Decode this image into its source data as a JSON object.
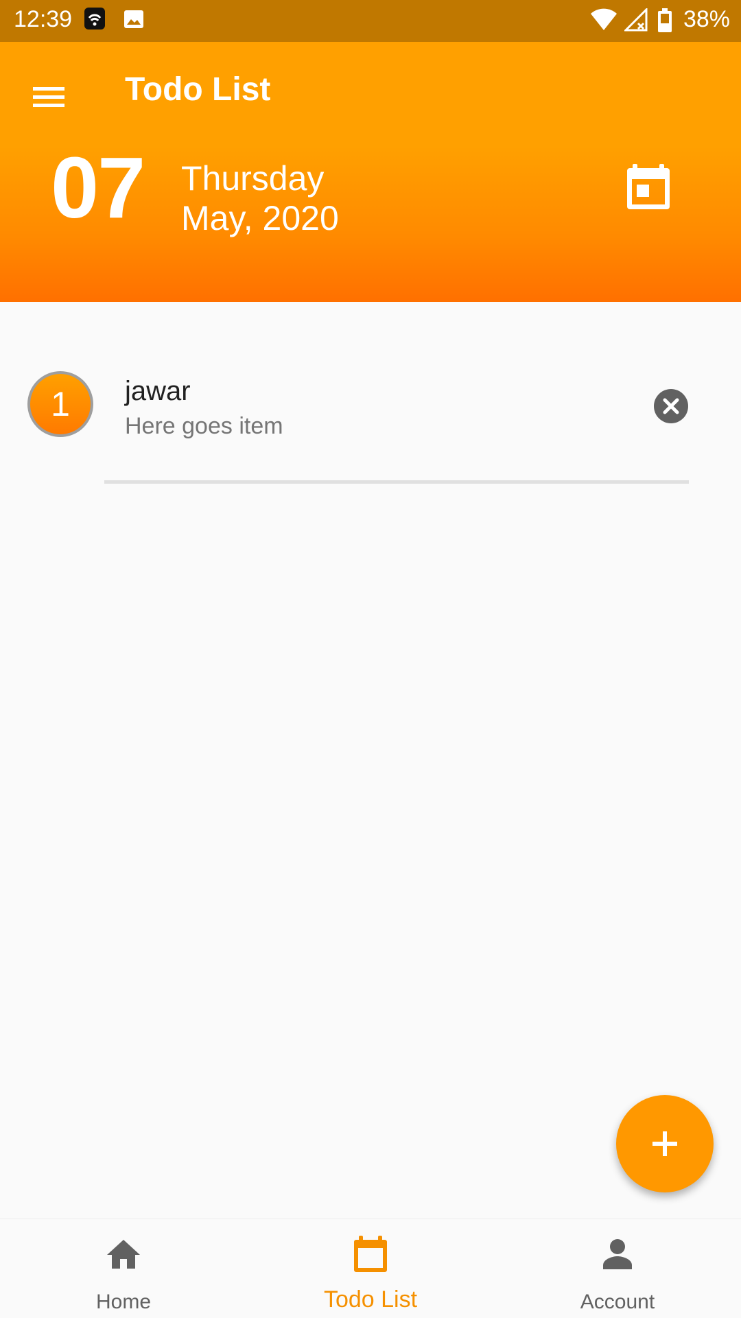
{
  "status_bar": {
    "time": "12:39",
    "battery": "38%",
    "icons": [
      "wifi-hotspot-icon",
      "image-icon",
      "wifi-icon",
      "signal-icon",
      "battery-icon"
    ]
  },
  "app_bar": {
    "title": "Todo List",
    "menu_icon": "menu-icon"
  },
  "date_header": {
    "day": "07",
    "weekday": "Thursday",
    "month_year": "May, 2020",
    "calendar_icon": "calendar-icon"
  },
  "todos": [
    {
      "index": "1",
      "title": "jawar",
      "subtitle": "Here goes item",
      "action_icon": "close-icon"
    }
  ],
  "fab": {
    "icon": "add-icon"
  },
  "bottom_nav": {
    "items": [
      {
        "label": "Home",
        "icon": "home-icon",
        "active": false
      },
      {
        "label": "Todo List",
        "icon": "calendar-icon",
        "active": true
      },
      {
        "label": "Account",
        "icon": "person-icon",
        "active": false
      }
    ]
  },
  "colors": {
    "accent": "#ff9800",
    "status_bar": "#c07800",
    "header_top": "#ffa000",
    "header_bottom": "#ff7000",
    "nav_inactive": "#616161",
    "nav_active": "#f59000"
  }
}
